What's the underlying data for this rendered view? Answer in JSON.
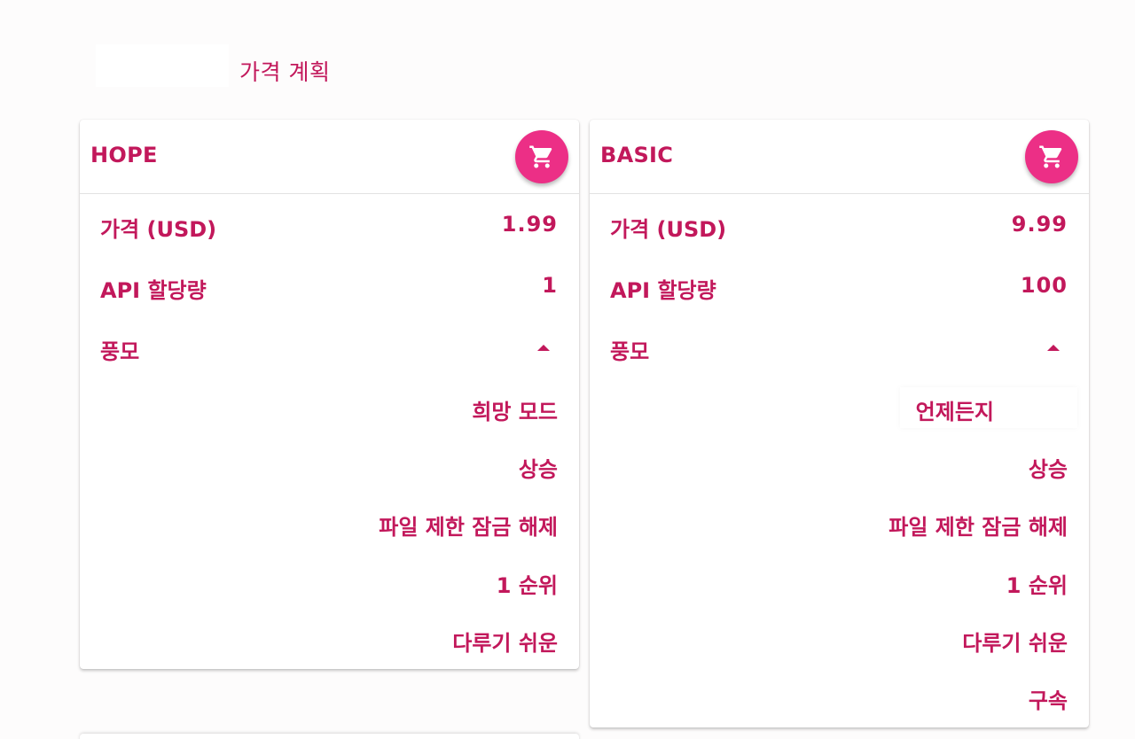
{
  "page": {
    "title": "가격 계획"
  },
  "plans": [
    {
      "name": "HOPE",
      "price_label": "가격 (USD)",
      "price_value": "1.99",
      "quota_label": "API 할당량",
      "quota_value": "1",
      "features_label": "풍모",
      "features": [
        "희망 모드",
        "상승",
        "파일 제한 잠금 해제",
        "1 순위",
        "다루기 쉬운"
      ]
    },
    {
      "name": "BASIC",
      "price_label": "가격 (USD)",
      "price_value": "9.99",
      "quota_label": "API 할당량",
      "quota_value": "100",
      "features_label": "풍모",
      "features": [
        "언제든지",
        "상승",
        "파일 제한 잠금 해제",
        "1 순위",
        "다루기 쉬운",
        "구속"
      ]
    }
  ],
  "icons": {
    "cart": "shopping-cart-icon",
    "expand": "caret-up-icon"
  },
  "colors": {
    "accent": "#c2185b",
    "cart_button": "#ec2f86",
    "background": "#fdfcfc"
  }
}
